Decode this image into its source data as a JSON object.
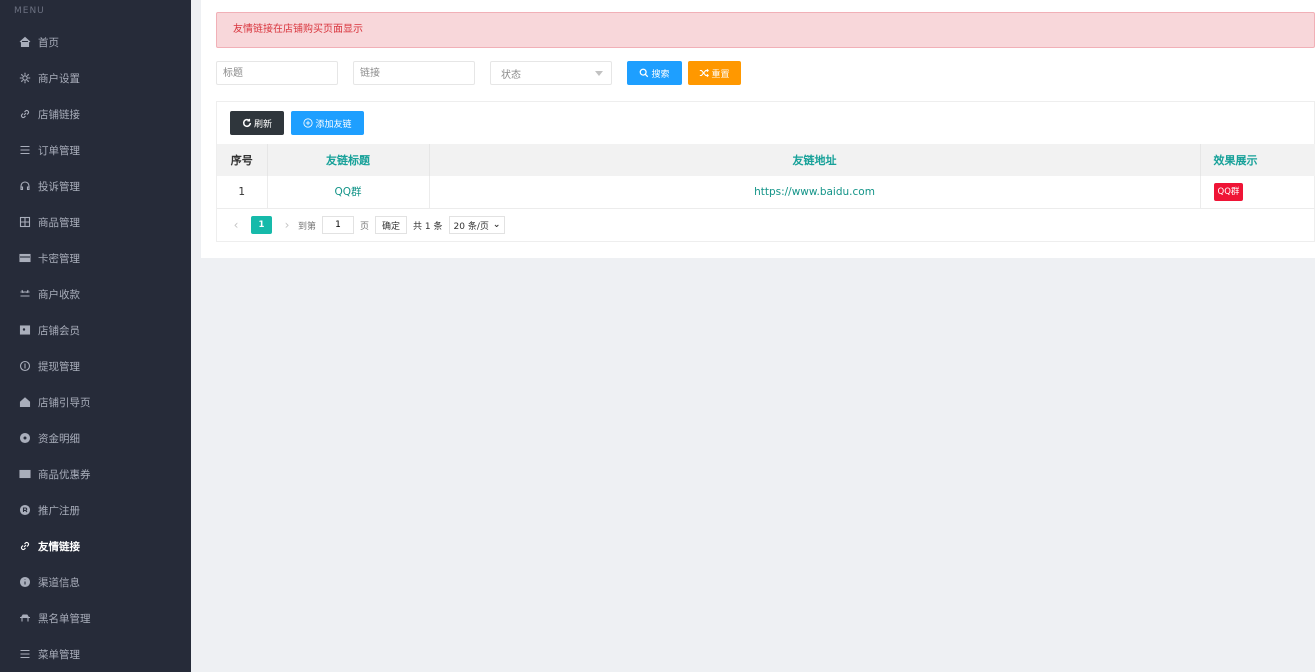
{
  "sidebar": {
    "menu_title": "MENU",
    "items": [
      {
        "label": "首页",
        "icon": "home-icon"
      },
      {
        "label": "商户设置",
        "icon": "gear-icon"
      },
      {
        "label": "店铺链接",
        "icon": "link-icon"
      },
      {
        "label": "订单管理",
        "icon": "list-icon"
      },
      {
        "label": "投诉管理",
        "icon": "headset-icon"
      },
      {
        "label": "商品管理",
        "icon": "grid-icon"
      },
      {
        "label": "卡密管理",
        "icon": "card-icon"
      },
      {
        "label": "商户收款",
        "icon": "payment-icon"
      },
      {
        "label": "店铺会员",
        "icon": "member-icon"
      },
      {
        "label": "提现管理",
        "icon": "coin-icon"
      },
      {
        "label": "店铺引导页",
        "icon": "house-icon"
      },
      {
        "label": "资金明细",
        "icon": "circle-icon"
      },
      {
        "label": "商品优惠券",
        "icon": "coupon-icon"
      },
      {
        "label": "推广注册",
        "icon": "register-icon"
      },
      {
        "label": "友情链接",
        "icon": "chain-icon",
        "active": true
      },
      {
        "label": "渠道信息",
        "icon": "info-icon"
      },
      {
        "label": "黑名单管理",
        "icon": "blacklist-icon"
      },
      {
        "label": "菜单管理",
        "icon": "menu-icon"
      }
    ]
  },
  "alert": {
    "text": "友情链接在店铺购买页面显示"
  },
  "filters": {
    "title_placeholder": "标题",
    "link_placeholder": "链接",
    "status_placeholder": "状态",
    "search_label": "搜索",
    "reset_label": "重置"
  },
  "toolbar": {
    "refresh_label": "刷新",
    "add_label": "添加友链"
  },
  "table": {
    "headers": [
      "序号",
      "友链标题",
      "友链地址",
      "效果展示"
    ],
    "rows": [
      {
        "num": "1",
        "title": "QQ群",
        "url": "https://www.baidu.com",
        "preview": "QQ群"
      }
    ]
  },
  "pagination": {
    "current_page": "1",
    "goto_label": "到第",
    "goto_value": "1",
    "page_unit": "页",
    "confirm_label": "确定",
    "total_text": "共 1 条",
    "page_size": "20 条/页"
  },
  "colors": {
    "sidebar_bg": "#262b39",
    "primary_blue": "#1e9fff",
    "reset_orange": "#ff9800",
    "teal": "#16baaa",
    "badge_red": "#ef1436",
    "alert_bg": "#f8d7da"
  }
}
